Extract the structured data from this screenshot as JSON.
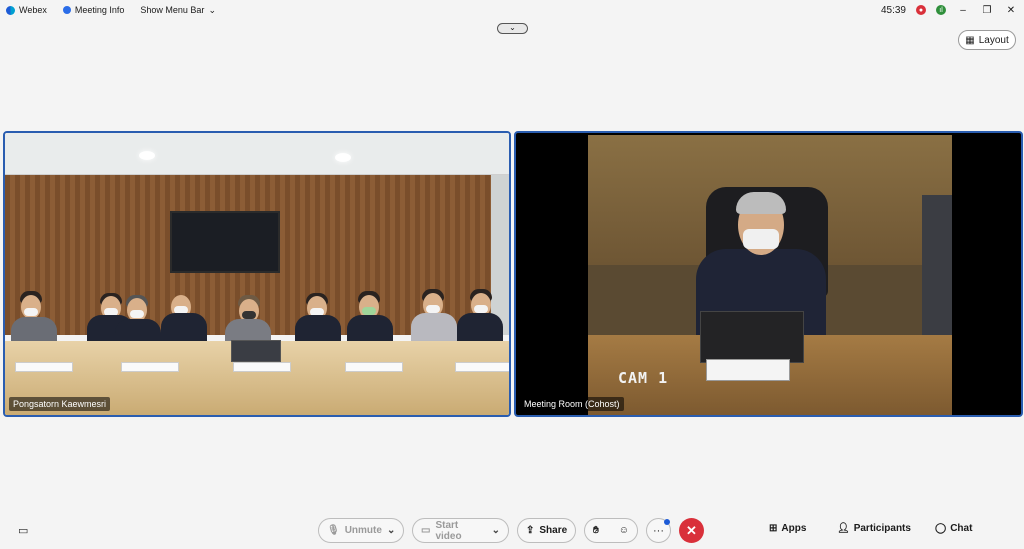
{
  "titlebar": {
    "app_name": "Webex",
    "meeting_info": "Meeting Info",
    "show_menu_bar": "Show Menu Bar",
    "timer": "45:39",
    "record_icon": "recording-icon",
    "signal_icon": "connection-icon"
  },
  "layout_button": "Layout",
  "videos": [
    {
      "participant_name": "Pongsatorn Kaewmesri"
    },
    {
      "participant_name": "Meeting Room (Cohost)",
      "overlay_text": "CAM 1"
    }
  ],
  "toolbar": {
    "unmute_label": "Unmute",
    "start_video_label": "Start video",
    "share_label": "Share",
    "more_label": "···",
    "end_label": "✕",
    "apps_label": "Apps",
    "participants_label": "Participants",
    "chat_label": "Chat"
  },
  "colors": {
    "accent": "#2a5db0",
    "end_call": "#d9303a"
  }
}
